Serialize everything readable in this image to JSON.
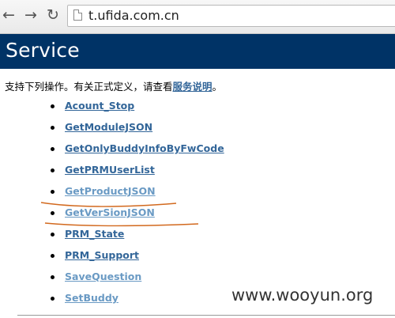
{
  "browser": {
    "back_icon": "←",
    "forward_icon": "→",
    "reload_icon": "↻",
    "url": "t.ufida.com.cn"
  },
  "header": {
    "title": "Service",
    "band_color": "#003366"
  },
  "intro": {
    "text": "支持下列操作。有关正式定义，请查看",
    "link": "服务说明",
    "suffix": "。"
  },
  "operations": [
    {
      "label": "Acount_Stop",
      "visited": false
    },
    {
      "label": "GetModuleJSON",
      "visited": false
    },
    {
      "label": "GetOnlyBuddyInfoByFwCode",
      "visited": false
    },
    {
      "label": "GetPRMUserList",
      "visited": false
    },
    {
      "label": "GetProductJSON",
      "visited": true
    },
    {
      "label": "GetVerSionJSON",
      "visited": true
    },
    {
      "label": "PRM_State",
      "visited": false
    },
    {
      "label": "PRM_Support",
      "visited": false
    },
    {
      "label": "SaveQuestion",
      "visited": true
    },
    {
      "label": "SetBuddy",
      "visited": true
    }
  ],
  "watermark": "www.wooyun.org",
  "colors": {
    "link": "#336699",
    "visited_link": "#6a9ac4",
    "underline_mark": "#d2691e"
  }
}
